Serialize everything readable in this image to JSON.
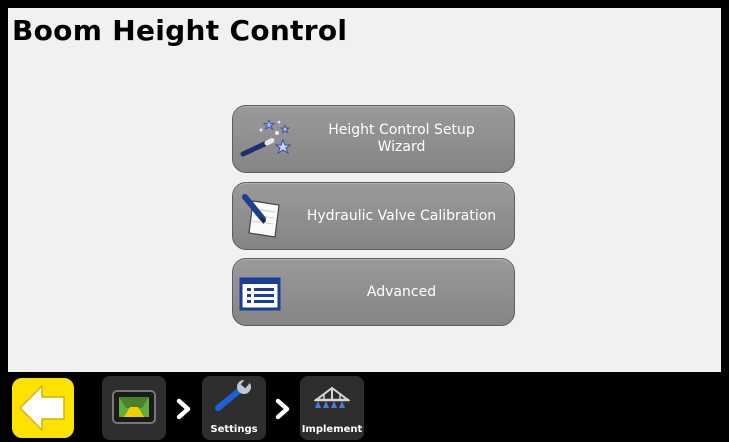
{
  "page": {
    "title": "Boom Height Control"
  },
  "menu": {
    "items": [
      {
        "label": "Height Control Setup\nWizard",
        "icon": "magic-wand-icon"
      },
      {
        "label": "Hydraulic Valve Calibration",
        "icon": "notepad-pen-icon"
      },
      {
        "label": "Advanced",
        "icon": "list-settings-icon"
      }
    ]
  },
  "bottombar": {
    "back_icon": "back-arrow-icon",
    "breadcrumbs": [
      {
        "label": "",
        "icon": "display-home-icon"
      },
      {
        "label": "Settings",
        "icon": "wrench-icon"
      },
      {
        "label": "Implement",
        "icon": "sprayer-boom-icon"
      }
    ]
  },
  "colors": {
    "background": "#f1f1f1",
    "button": "#8f8f8f",
    "back_button": "#ffe300",
    "bar": "#000000",
    "crumb": "#2e2e2e"
  }
}
